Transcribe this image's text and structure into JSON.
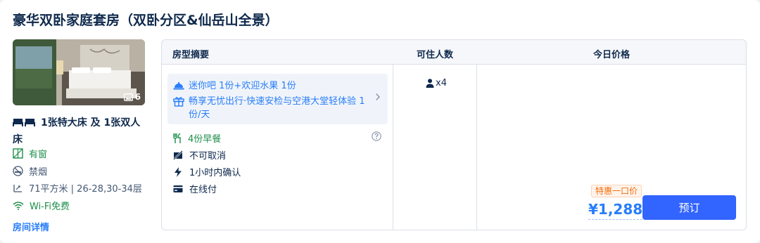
{
  "room": {
    "title": "豪华双卧家庭套房（双卧分区&仙岳山全景）",
    "photo_count": "6",
    "bed_text": "1张特大床 及 1张双人床",
    "facilities": {
      "window": "有窗",
      "smoking": "禁烟",
      "area_floor": "71平方米 | 26-28,30-34层",
      "wifi": "Wi-Fi免费"
    },
    "details_link": "房间详情"
  },
  "table": {
    "headers": {
      "summary": "房型摘要",
      "occupancy": "可住人数",
      "price": "今日价格"
    },
    "perks": [
      {
        "text": "迷你吧 1份+欢迎水果 1份",
        "icon": "dome-icon"
      },
      {
        "text": "畅享无忧出行·快速安检与空港大堂轻体验 1份/天",
        "icon": "gift-icon"
      }
    ],
    "policies": {
      "breakfast": "4份早餐",
      "cancellation": "不可取消",
      "confirmation": "1小时内确认",
      "payment": "在线付"
    },
    "occupancy": "x4",
    "promo_tag": "特惠一口价",
    "price": "¥1,288",
    "book_label": "预订"
  },
  "colors": {
    "accent": "#287dfa",
    "button": "#3264ff",
    "green": "#1d8f4a",
    "promo": "#f26d0a"
  }
}
